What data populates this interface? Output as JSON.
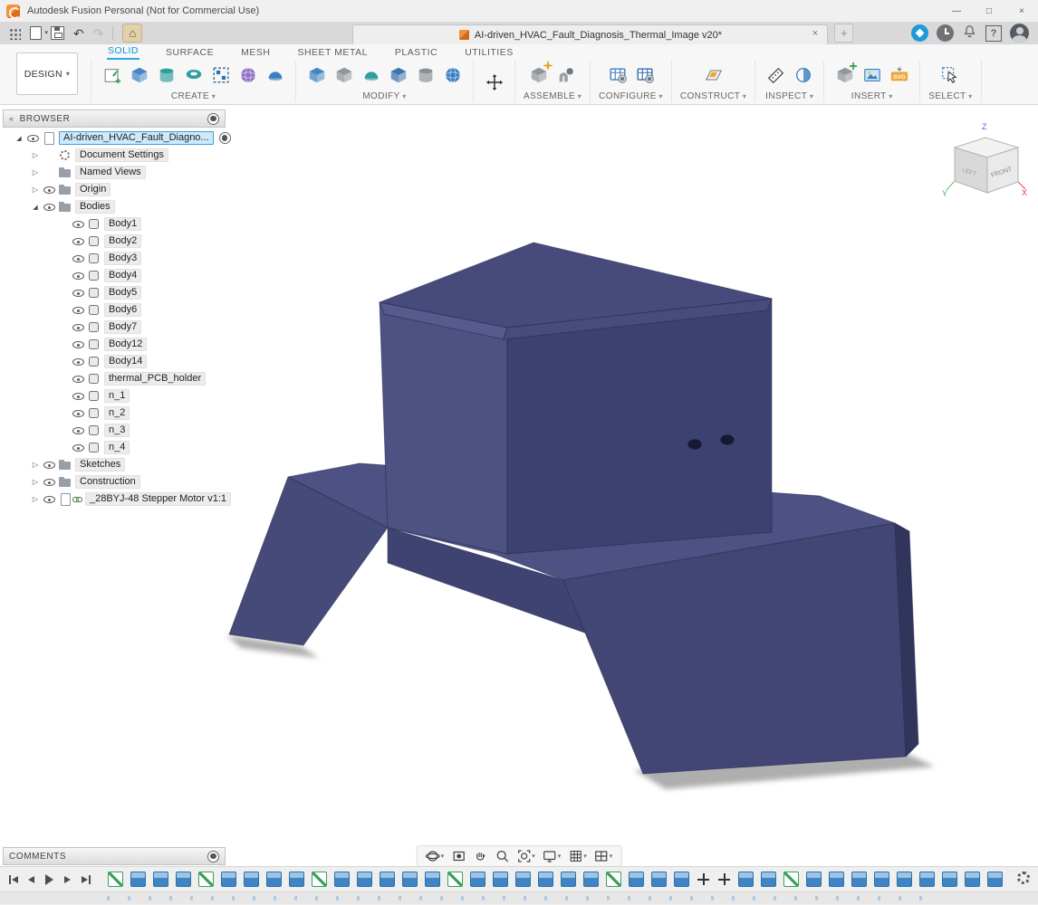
{
  "palette": {
    "accent": "#0696d7",
    "selection_blue": "#3e9ed9",
    "logo_orange": "#e8742c",
    "timeline_blue": "#3f84c4",
    "shadow": "#9a9a9a",
    "model_top": "#474b7c",
    "model_left": "#4e5283",
    "model_right": "#3d4170",
    "model_platform": "#4d5183",
    "model_slope": "#434674",
    "model_leg": "#464a79",
    "model_band": "#3f4372",
    "model_side": "#31355c",
    "model_cham1": "#565a8c",
    "model_cham2": "#484c7d",
    "model_hole": "#161931",
    "model_edge": "#23264a"
  },
  "title_bar": {
    "app_title": "Autodesk Fusion Personal (Not for Commercial Use)",
    "controls": {
      "minimize": "—",
      "maximize": "□",
      "close": "×"
    }
  },
  "tab_bar": {
    "document_tab": "AI-driven_HVAC_Fault_Diagnosis_Thermal_Image v20*",
    "close_tab_glyph": "×",
    "new_tab_glyph": "+"
  },
  "ribbon": {
    "design_button": "DESIGN",
    "tabs": [
      "SOLID",
      "SURFACE",
      "MESH",
      "SHEET METAL",
      "PLASTIC",
      "UTILITIES"
    ],
    "active_tab": "SOLID",
    "groups": {
      "create": "CREATE",
      "modify": "MODIFY",
      "assemble": "ASSEMBLE",
      "configure": "CONFIGURE",
      "construct": "CONSTRUCT",
      "inspect": "INSPECT",
      "insert": "INSERT",
      "select": "SELECT"
    },
    "insert_svg_badge": "SVG"
  },
  "browser": {
    "header": "BROWSER",
    "rows": [
      {
        "label": "AI-driven_HVAC_Fault_Diagno...",
        "icon": "component",
        "level": 0,
        "expander": "expanded",
        "eye": true,
        "selected": true,
        "radio": true
      },
      {
        "label": "Document Settings",
        "icon": "gear",
        "level": 1,
        "expander": "collapsed",
        "eye": false
      },
      {
        "label": "Named Views",
        "icon": "folder",
        "level": 1,
        "expander": "collapsed",
        "eye": false
      },
      {
        "label": "Origin",
        "icon": "folder",
        "level": 1,
        "expander": "collapsed",
        "eye": true
      },
      {
        "label": "Bodies",
        "icon": "folder",
        "level": 1,
        "expander": "expanded",
        "eye": true
      },
      {
        "label": "Body1",
        "icon": "body",
        "level": 2,
        "eye": true
      },
      {
        "label": "Body2",
        "icon": "body",
        "level": 2,
        "eye": true
      },
      {
        "label": "Body3",
        "icon": "body",
        "level": 2,
        "eye": true
      },
      {
        "label": "Body4",
        "icon": "body",
        "level": 2,
        "eye": true
      },
      {
        "label": "Body5",
        "icon": "body",
        "level": 2,
        "eye": true
      },
      {
        "label": "Body6",
        "icon": "body",
        "level": 2,
        "eye": true
      },
      {
        "label": "Body7",
        "icon": "body",
        "level": 2,
        "eye": true
      },
      {
        "label": "Body12",
        "icon": "body",
        "level": 2,
        "eye": true
      },
      {
        "label": "Body14",
        "icon": "body",
        "level": 2,
        "eye": true
      },
      {
        "label": "thermal_PCB_holder",
        "icon": "body",
        "level": 2,
        "eye": true
      },
      {
        "label": "n_1",
        "icon": "body",
        "level": 2,
        "eye": true
      },
      {
        "label": "n_2",
        "icon": "body",
        "level": 2,
        "eye": true
      },
      {
        "label": "n_3",
        "icon": "body",
        "level": 2,
        "eye": true
      },
      {
        "label": "n_4",
        "icon": "body",
        "level": 2,
        "eye": true
      },
      {
        "label": "Sketches",
        "icon": "folder",
        "level": 1,
        "expander": "collapsed",
        "eye": true
      },
      {
        "label": "Construction",
        "icon": "folder",
        "level": 1,
        "expander": "collapsed",
        "eye": true
      },
      {
        "label": "_28BYJ-48 Stepper Motor v1:1",
        "icon": "component-link",
        "level": 1,
        "expander": "collapsed",
        "eye": true
      }
    ]
  },
  "viewcube": {
    "front": "FRONT",
    "left": "LEFT",
    "x": "X",
    "y": "Y",
    "z": "Z"
  },
  "comments": {
    "header": "COMMENTS"
  },
  "timeline": {
    "features": [
      "sketch",
      "extrude",
      "extrude",
      "extrude",
      "sketch",
      "extrude",
      "extrude",
      "extrude",
      "extrude",
      "sketch",
      "extrude",
      "extrude",
      "extrude",
      "extrude",
      "extrude",
      "sketch",
      "extrude",
      "extrude",
      "extrude",
      "extrude",
      "extrude",
      "extrude",
      "sketch",
      "extrude",
      "extrude",
      "extrude",
      "move",
      "move",
      "extrude",
      "extrude",
      "sketch",
      "extrude",
      "extrude",
      "extrude",
      "extrude",
      "extrude",
      "extrude",
      "extrude",
      "extrude",
      "extrude"
    ]
  }
}
